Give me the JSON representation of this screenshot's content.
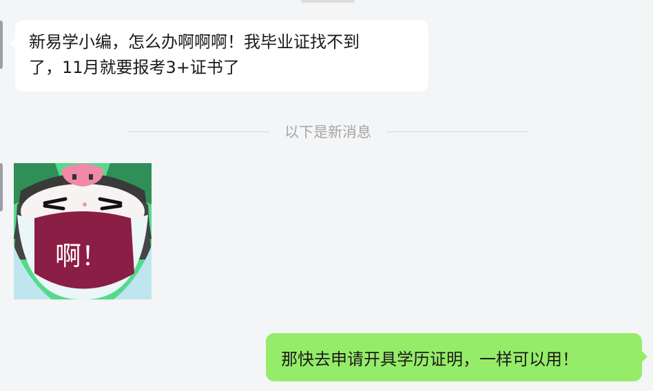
{
  "chat": {
    "messages": [
      {
        "direction": "incoming",
        "type": "text",
        "line1": "新易学小编，怎么办啊啊啊！我毕业证找不到",
        "line2": "了，11月就要报考3+证书了"
      },
      {
        "direction": "incoming",
        "type": "sticker",
        "sticker_text": "啊！"
      },
      {
        "direction": "outgoing",
        "type": "text",
        "text": "那快去申请开具学历证明，一样可以用！"
      }
    ],
    "new_messages_divider": "以下是新消息"
  },
  "colors": {
    "background": "#f4f5f7",
    "incoming_bubble": "#ffffff",
    "outgoing_bubble": "#95ec69",
    "divider_text": "#a6a6a6",
    "sticker_bg": "#55d98a",
    "sticker_mouth": "#8b1e45"
  },
  "icons": {
    "sticker": "crying-cartoon-sticker-icon"
  }
}
